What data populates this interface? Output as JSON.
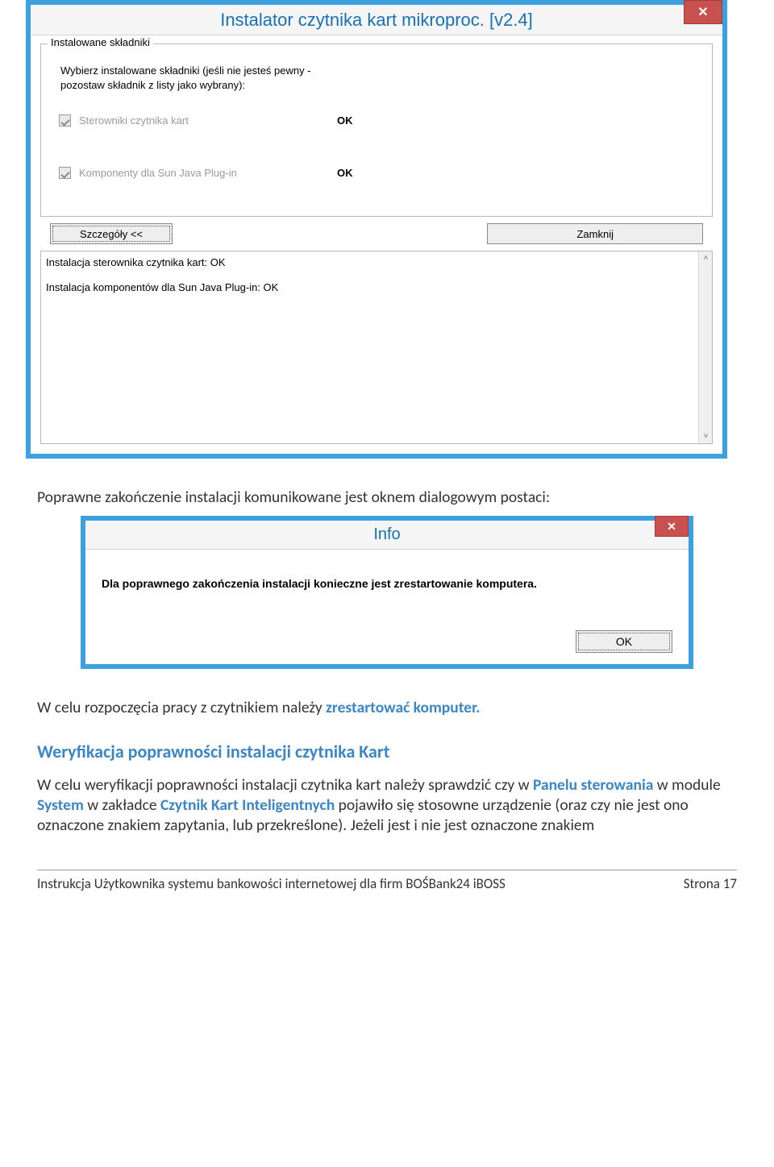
{
  "installer": {
    "title": "Instalator czytnika kart mikroproc. [v2.4]",
    "close_glyph": "✕",
    "group_legend": "Instalowane składniki",
    "instruction_l1": "Wybierz instalowane składniki (jeśli nie jesteś pewny -",
    "instruction_l2": "pozostaw składnik z listy jako wybrany):",
    "components": [
      {
        "label": "Sterowniki czytnika kart",
        "status": "OK"
      },
      {
        "label": "Komponenty dla Sun Java Plug-in",
        "status": "OK"
      }
    ],
    "btn_details": "Szczegóły <<",
    "btn_close": "Zamknij",
    "log_lines": [
      "Instalacja sterownika czytnika kart: OK",
      "Instalacja komponentów dla Sun Java Plug-in: OK"
    ],
    "scroll_up": "˄",
    "scroll_down": "˅"
  },
  "para1": "Poprawne zakończenie instalacji komunikowane jest oknem dialogowym postaci:",
  "info_dialog": {
    "title": "Info",
    "close_glyph": "✕",
    "message": "Dla poprawnego zakończenia instalacji konieczne jest zrestartowanie komputera.",
    "ok": "OK"
  },
  "para2_a": "W celu rozpoczęcia pracy z czytnikiem należy ",
  "para2_b": "zrestartować komputer.",
  "section_title": "Weryfikacja poprawności instalacji czytnika Kart",
  "para3_a": "W celu weryfikacji poprawności instalacji czytnika kart należy sprawdzić czy w ",
  "para3_b": "Panelu sterowania",
  "para3_c": " w module ",
  "para3_d": "System",
  "para3_e": " w zakładce ",
  "para3_f": "Czytnik Kart Inteligentnych",
  "para3_g": " pojawiło się stosowne urządzenie (oraz czy nie jest ono oznaczone znakiem zapytania, lub przekreślone). Jeżeli jest i nie jest oznaczone znakiem",
  "footer": {
    "left": "Instrukcja Użytkownika systemu bankowości internetowej dla firm BOŚBank24 iBOSS",
    "right": "Strona 17"
  }
}
